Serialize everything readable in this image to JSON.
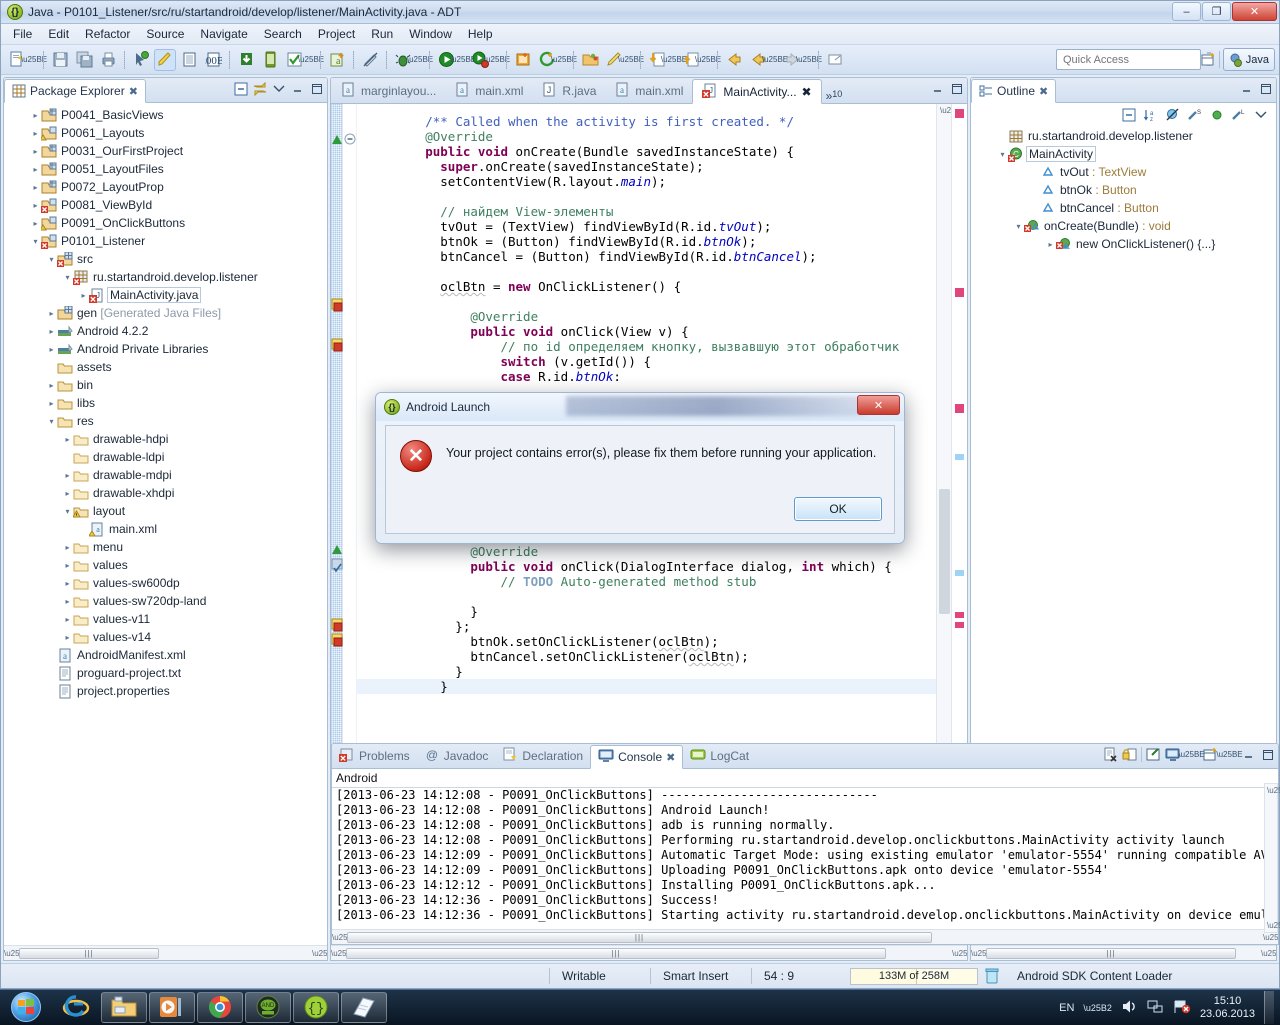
{
  "window": {
    "title": "Java - P0101_Listener/src/ru/startandroid/develop/listener/MainActivity.java - ADT",
    "minimize_label": "–",
    "maximize_label": "❐",
    "close_label": "✕"
  },
  "menu": [
    "File",
    "Edit",
    "Refactor",
    "Source",
    "Navigate",
    "Search",
    "Project",
    "Run",
    "Window",
    "Help"
  ],
  "toolbar": {
    "quick_access_placeholder": "Quick Access",
    "perspective_label": "Java"
  },
  "package_explorer": {
    "tab_label": "Package Explorer",
    "close_label": "✖",
    "items": [
      {
        "label": "P0041_BasicViews",
        "indent": 1,
        "arrow": "closed",
        "icon": "project-icon"
      },
      {
        "label": "P0061_Layouts",
        "indent": 1,
        "arrow": "closed",
        "icon": "project-warn-icon"
      },
      {
        "label": "P0031_OurFirstProject",
        "indent": 1,
        "arrow": "closed",
        "icon": "project-icon"
      },
      {
        "label": "P0051_LayoutFiles",
        "indent": 1,
        "arrow": "closed",
        "icon": "project-icon"
      },
      {
        "label": "P0072_LayoutProp",
        "indent": 1,
        "arrow": "closed",
        "icon": "project-icon"
      },
      {
        "label": "P0081_ViewById",
        "indent": 1,
        "arrow": "closed",
        "icon": "project-error-icon"
      },
      {
        "label": "P0091_OnClickButtons",
        "indent": 1,
        "arrow": "closed",
        "icon": "project-warn-icon"
      },
      {
        "label": "P0101_Listener",
        "indent": 1,
        "arrow": "open",
        "icon": "project-error-icon"
      },
      {
        "label": "src",
        "indent": 2,
        "arrow": "open",
        "icon": "package-root-error-icon"
      },
      {
        "label": "ru.startandroid.develop.listener",
        "indent": 3,
        "arrow": "open",
        "icon": "package-error-icon"
      },
      {
        "label": "MainActivity.java",
        "indent": 4,
        "arrow": "closed",
        "icon": "java-error-icon",
        "selected": true
      },
      {
        "label": "gen",
        "suffix": " [Generated Java Files]",
        "indent": 2,
        "arrow": "closed",
        "icon": "package-root-icon"
      },
      {
        "label": "Android 4.2.2",
        "indent": 2,
        "arrow": "closed",
        "icon": "library-icon"
      },
      {
        "label": "Android Private Libraries",
        "indent": 2,
        "arrow": "closed",
        "icon": "library-icon"
      },
      {
        "label": "assets",
        "indent": 2,
        "arrow": "none",
        "icon": "folder-icon"
      },
      {
        "label": "bin",
        "indent": 2,
        "arrow": "closed",
        "icon": "folder-icon"
      },
      {
        "label": "libs",
        "indent": 2,
        "arrow": "closed",
        "icon": "folder-icon"
      },
      {
        "label": "res",
        "indent": 2,
        "arrow": "open",
        "icon": "folder-icon"
      },
      {
        "label": "drawable-hdpi",
        "indent": 3,
        "arrow": "closed",
        "icon": "folder-plain-icon"
      },
      {
        "label": "drawable-ldpi",
        "indent": 3,
        "arrow": "none",
        "icon": "folder-plain-icon"
      },
      {
        "label": "drawable-mdpi",
        "indent": 3,
        "arrow": "closed",
        "icon": "folder-plain-icon"
      },
      {
        "label": "drawable-xhdpi",
        "indent": 3,
        "arrow": "closed",
        "icon": "folder-plain-icon"
      },
      {
        "label": "layout",
        "indent": 3,
        "arrow": "open",
        "icon": "folder-warn-icon"
      },
      {
        "label": "main.xml",
        "indent": 4,
        "arrow": "none",
        "icon": "xml-warn-icon"
      },
      {
        "label": "menu",
        "indent": 3,
        "arrow": "closed",
        "icon": "folder-plain-icon"
      },
      {
        "label": "values",
        "indent": 3,
        "arrow": "closed",
        "icon": "folder-plain-icon"
      },
      {
        "label": "values-sw600dp",
        "indent": 3,
        "arrow": "closed",
        "icon": "folder-plain-icon"
      },
      {
        "label": "values-sw720dp-land",
        "indent": 3,
        "arrow": "closed",
        "icon": "folder-plain-icon"
      },
      {
        "label": "values-v11",
        "indent": 3,
        "arrow": "closed",
        "icon": "folder-plain-icon"
      },
      {
        "label": "values-v14",
        "indent": 3,
        "arrow": "closed",
        "icon": "folder-plain-icon"
      },
      {
        "label": "AndroidManifest.xml",
        "indent": 2,
        "arrow": "none",
        "icon": "xml-icon"
      },
      {
        "label": "proguard-project.txt",
        "indent": 2,
        "arrow": "none",
        "icon": "text-icon"
      },
      {
        "label": "project.properties",
        "indent": 2,
        "arrow": "none",
        "icon": "text-icon"
      }
    ]
  },
  "editor": {
    "tabs": [
      {
        "label": "marginlayou...",
        "icon": "xml-icon",
        "active": false
      },
      {
        "label": "main.xml",
        "icon": "xml-icon",
        "active": false
      },
      {
        "label": "R.java",
        "icon": "java-icon",
        "active": false
      },
      {
        "label": "main.xml",
        "icon": "xml-icon",
        "active": false
      },
      {
        "label": "MainActivity...",
        "icon": "java-error-icon",
        "active": true,
        "close_label": "✖"
      }
    ],
    "more_tabs_count": "10",
    "more_tabs_glyph": "»",
    "code_lines": [
      {
        "segments": [
          {
            "t": "/** Called when the activity is first created. */",
            "c": "jd"
          }
        ],
        "indent": 8
      },
      {
        "segments": [
          {
            "t": "@Override",
            "c": "cm"
          }
        ],
        "indent": 8
      },
      {
        "segments": [
          {
            "t": "public",
            "c": "kw"
          },
          {
            "t": " "
          },
          {
            "t": "void",
            "c": "kw"
          },
          {
            "t": " onCreate(Bundle savedInstanceState) {"
          }
        ],
        "indent": 8
      },
      {
        "segments": [
          {
            "t": "super",
            "c": "kw"
          },
          {
            "t": ".onCreate(savedInstanceState);"
          }
        ],
        "indent": 10
      },
      {
        "segments": [
          {
            "t": "setContentView(R.layout."
          },
          {
            "t": "main",
            "c": "stat"
          },
          {
            "t": ");"
          }
        ],
        "indent": 10
      },
      {
        "segments": [
          {
            "t": ""
          }
        ],
        "indent": 0
      },
      {
        "segments": [
          {
            "t": "// найдем View-элементы",
            "c": "cm"
          }
        ],
        "indent": 10
      },
      {
        "segments": [
          {
            "t": "tvOut = (TextView) findViewById(R.id."
          },
          {
            "t": "tvOut",
            "c": "stat"
          },
          {
            "t": ");"
          }
        ],
        "indent": 10
      },
      {
        "segments": [
          {
            "t": "btnOk = (Button) findViewById(R.id."
          },
          {
            "t": "btnOk",
            "c": "stat"
          },
          {
            "t": ");"
          }
        ],
        "indent": 10
      },
      {
        "segments": [
          {
            "t": "btnCancel = (Button) findViewById(R.id."
          },
          {
            "t": "btnCancel",
            "c": "stat"
          },
          {
            "t": ");"
          }
        ],
        "indent": 10
      },
      {
        "segments": [
          {
            "t": ""
          }
        ],
        "indent": 0
      },
      {
        "segments": [
          {
            "t": "oclBtn",
            "c": "wavy"
          },
          {
            "t": " = "
          },
          {
            "t": "new",
            "c": "kw"
          },
          {
            "t": " OnClickListener() {"
          }
        ],
        "indent": 10
      },
      {
        "segments": [
          {
            "t": ""
          }
        ],
        "indent": 0
      },
      {
        "segments": [
          {
            "t": "@Override",
            "c": "cm"
          }
        ],
        "indent": 14
      },
      {
        "segments": [
          {
            "t": "public",
            "c": "kw"
          },
          {
            "t": " "
          },
          {
            "t": "void",
            "c": "kw"
          },
          {
            "t": " onClick(View v) {"
          }
        ],
        "indent": 14
      },
      {
        "segments": [
          {
            "t": "// по id определяем кнопку, вызвавшую этот обработчик",
            "c": "cm"
          }
        ],
        "indent": 18
      },
      {
        "segments": [
          {
            "t": "switch",
            "c": "kw"
          },
          {
            "t": " (v.getId()) {"
          }
        ],
        "indent": 18
      },
      {
        "segments": [
          {
            "t": "case",
            "c": "kw"
          },
          {
            "t": " R.id."
          },
          {
            "t": "btnOk",
            "c": "stat"
          },
          {
            "t": ":"
          }
        ],
        "indent": 18
      }
    ],
    "code_lines_below": [
      {
        "segments": [
          {
            "t": "@Override",
            "c": "cm"
          }
        ],
        "indent": 14
      },
      {
        "segments": [
          {
            "t": "public",
            "c": "kw"
          },
          {
            "t": " "
          },
          {
            "t": "void",
            "c": "kw"
          },
          {
            "t": " onClick(DialogInterface dialog, "
          },
          {
            "t": "int",
            "c": "kw"
          },
          {
            "t": " which) {"
          }
        ],
        "indent": 14
      },
      {
        "segments": [
          {
            "t": "// ",
            "c": "cm"
          },
          {
            "t": "TODO",
            "c": "todo"
          },
          {
            "t": " Auto-generated method stub",
            "c": "cm"
          }
        ],
        "indent": 18
      },
      {
        "segments": [
          {
            "t": ""
          }
        ],
        "indent": 0
      },
      {
        "segments": [
          {
            "t": "}"
          }
        ],
        "indent": 14
      },
      {
        "segments": [
          {
            "t": "};"
          }
        ],
        "indent": 12
      },
      {
        "segments": [
          {
            "t": "btnOk.setOnClickListener("
          },
          {
            "t": "oclBtn",
            "c": "wavy"
          },
          {
            "t": ");"
          }
        ],
        "indent": 14
      },
      {
        "segments": [
          {
            "t": "btnCancel.setOnClickListener("
          },
          {
            "t": "oclBtn",
            "c": "wavy"
          },
          {
            "t": ");"
          }
        ],
        "indent": 14
      },
      {
        "segments": [
          {
            "t": "}"
          }
        ],
        "indent": 12
      },
      {
        "segments": [
          {
            "t": "}"
          }
        ],
        "indent": 10,
        "highlight": true
      }
    ]
  },
  "outline": {
    "tab_label": "Outline",
    "close_label": "✖",
    "items": [
      {
        "label": "ru.startandroid.develop.listener",
        "indent": 1,
        "arrow": "none",
        "icon": "package-icon",
        "type": ""
      },
      {
        "label": "MainActivity",
        "indent": 1,
        "arrow": "open",
        "icon": "class-error-icon",
        "selected": true,
        "type": ""
      },
      {
        "label": "tvOut",
        "indent": 3,
        "arrow": "none",
        "icon": "field-icon",
        "type": " : TextView"
      },
      {
        "label": "btnOk",
        "indent": 3,
        "arrow": "none",
        "icon": "field-icon",
        "type": " : Button"
      },
      {
        "label": "btnCancel",
        "indent": 3,
        "arrow": "none",
        "icon": "field-icon",
        "type": " : Button"
      },
      {
        "label": "onCreate(Bundle)",
        "indent": 2,
        "arrow": "open",
        "icon": "method-error-icon",
        "type": " : void"
      },
      {
        "label": "new OnClickListener() {...}",
        "indent": 4,
        "arrow": "closed",
        "icon": "anon-class-error-icon",
        "type": ""
      }
    ]
  },
  "bottom_panel": {
    "tabs": [
      {
        "label": "Problems",
        "icon": "problems-icon",
        "active": false
      },
      {
        "label": "Javadoc",
        "icon": "javadoc-icon",
        "active": false
      },
      {
        "label": "Declaration",
        "icon": "declaration-icon",
        "active": false
      },
      {
        "label": "Console",
        "icon": "console-icon",
        "active": true,
        "close_label": "✖"
      },
      {
        "label": "LogCat",
        "icon": "logcat-icon",
        "active": false
      }
    ],
    "console_title": "Android",
    "console_lines": [
      "[2013-06-23 14:12:08 - P0091_OnClickButtons] ------------------------------",
      "[2013-06-23 14:12:08 - P0091_OnClickButtons] Android Launch!",
      "[2013-06-23 14:12:08 - P0091_OnClickButtons] adb is running normally.",
      "[2013-06-23 14:12:08 - P0091_OnClickButtons] Performing ru.startandroid.develop.onclickbuttons.MainActivity activity launch",
      "[2013-06-23 14:12:09 - P0091_OnClickButtons] Automatic Target Mode: using existing emulator 'emulator-5554' running compatible AVD",
      "[2013-06-23 14:12:09 - P0091_OnClickButtons] Uploading P0091_OnClickButtons.apk onto device 'emulator-5554'",
      "[2013-06-23 14:12:12 - P0091_OnClickButtons] Installing P0091_OnClickButtons.apk...",
      "[2013-06-23 14:12:36 - P0091_OnClickButtons] Success!",
      "[2013-06-23 14:12:36 - P0091_OnClickButtons] Starting activity ru.startandroid.develop.onclickbuttons.MainActivity on device emulat"
    ]
  },
  "statusbar": {
    "writable": "Writable",
    "insert_mode": "Smart Insert",
    "cursor_position": "54 : 9",
    "memory": "133M of 258M",
    "task": "Android SDK Content Loader"
  },
  "dialog": {
    "title": "Android Launch",
    "close_label": "✕",
    "message": "Your project contains error(s), please fix them before running your application.",
    "ok_label": "OK",
    "error_glyph": "✕"
  },
  "taskbar": {
    "language": "EN",
    "time": "15:10",
    "date": "23.06.2013"
  }
}
